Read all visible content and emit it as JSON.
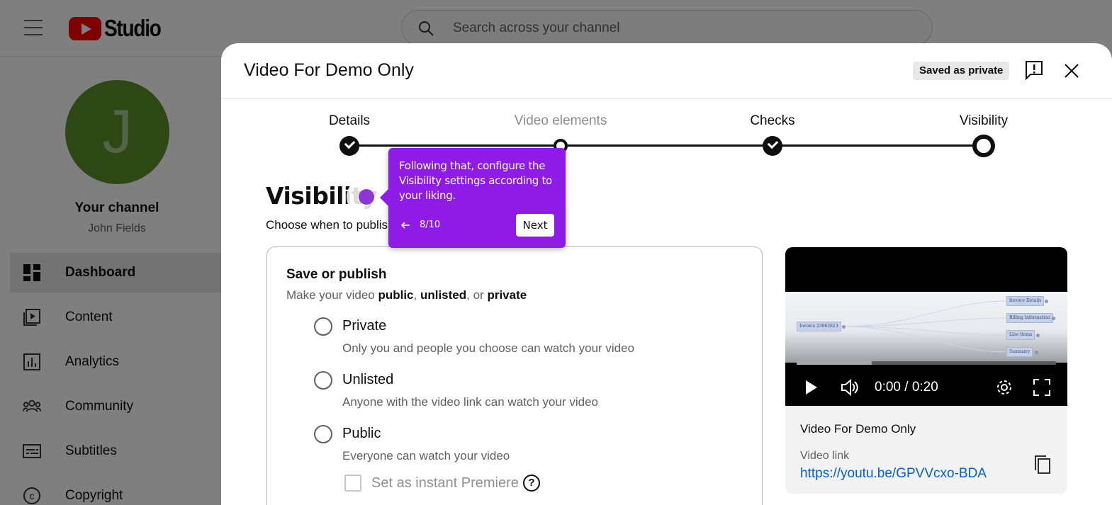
{
  "app": {
    "logo_text": "Studio",
    "search": {
      "placeholder": "Search across your channel"
    }
  },
  "sidebar": {
    "avatar_initial": "J",
    "channel_title": "Your channel",
    "channel_name": "John Fields",
    "items": [
      {
        "label": "Dashboard",
        "icon": "dashboard-icon",
        "active": true
      },
      {
        "label": "Content",
        "icon": "content-icon"
      },
      {
        "label": "Analytics",
        "icon": "analytics-icon"
      },
      {
        "label": "Community",
        "icon": "community-icon"
      },
      {
        "label": "Subtitles",
        "icon": "subtitles-icon"
      },
      {
        "label": "Copyright",
        "icon": "copyright-icon"
      }
    ]
  },
  "modal": {
    "title": "Video For Demo Only",
    "saved_badge": "Saved as private",
    "steps": [
      {
        "label": "Details",
        "state": "done"
      },
      {
        "label": "Video elements",
        "state": "current"
      },
      {
        "label": "Checks",
        "state": "done"
      },
      {
        "label": "Visibility",
        "state": "active"
      }
    ],
    "visibility": {
      "heading": "Visibility",
      "subheading": "Choose when to publis",
      "card": {
        "title": "Save or publish",
        "subtitle_prefix": "Make your video ",
        "subtitle_public": "public",
        "subtitle_sep1": ", ",
        "subtitle_unlisted": "unlisted",
        "subtitle_sep2": ", or ",
        "subtitle_private": "private",
        "options": [
          {
            "label": "Private",
            "description": "Only you and people you choose can watch your video"
          },
          {
            "label": "Unlisted",
            "description": "Anyone with the video link can watch your video"
          },
          {
            "label": "Public",
            "description": "Everyone can watch your video"
          }
        ],
        "premiere_label": "Set as instant Premiere",
        "help_glyph": "?"
      }
    },
    "preview": {
      "time": "0:00 / 0:20",
      "progress": 0.29,
      "video_title": "Video For Demo Only",
      "link_label": "Video link",
      "link_url": "https://youtu.be/GPVVcxo-BDA",
      "mindmap": {
        "root": "Invoice 23062023",
        "branches": [
          "Invoice Details",
          "Billing Information",
          "Line Items",
          "Summary"
        ]
      }
    }
  },
  "tour": {
    "text": "Following that, configure the Visibility settings according to your liking.",
    "step": "8/10",
    "next_label": "Next",
    "accent": "#8e1be6"
  }
}
